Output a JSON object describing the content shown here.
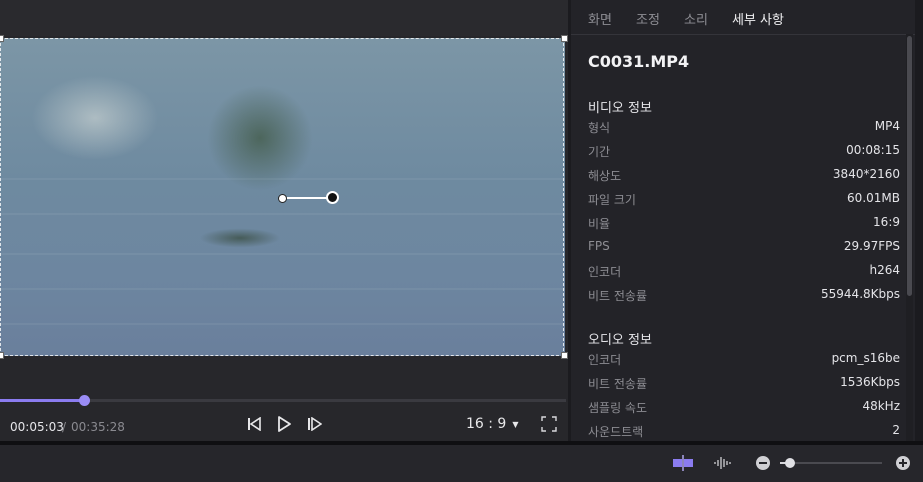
{
  "player": {
    "time_current": "00:05:03",
    "time_separator": "/",
    "time_total": "00:35:28",
    "progress_fraction": 0.148,
    "aspect_ratio": "16 : 9",
    "icons": {
      "prev_frame": "step-back-icon",
      "play": "play-icon",
      "next_frame": "step-forward-icon",
      "dropdown": "caret-down-icon",
      "fullscreen": "fullscreen-icon"
    }
  },
  "tabs": [
    {
      "label": "화면",
      "active": false
    },
    {
      "label": "조정",
      "active": false
    },
    {
      "label": "소리",
      "active": false
    },
    {
      "label": "세부 사항",
      "active": true
    }
  ],
  "file": {
    "name": "C0031.MP4"
  },
  "video_info": {
    "heading": "비디오 정보",
    "rows": [
      {
        "key": "형식",
        "value": "MP4"
      },
      {
        "key": "기간",
        "value": "00:08:15"
      },
      {
        "key": "해상도",
        "value": "3840*2160"
      },
      {
        "key": "파일 크기",
        "value": "60.01MB"
      },
      {
        "key": "비율",
        "value": "16:9"
      },
      {
        "key": "FPS",
        "value": "29.97FPS"
      },
      {
        "key": "인코더",
        "value": "h264"
      },
      {
        "key": "비트 전송률",
        "value": "55944.8Kbps"
      }
    ]
  },
  "audio_info": {
    "heading": "오디오 정보",
    "rows": [
      {
        "key": "인코더",
        "value": "pcm_s16be"
      },
      {
        "key": "비트 전송률",
        "value": "1536Kbps"
      },
      {
        "key": "샘플링 속도",
        "value": "48kHz"
      },
      {
        "key": "사운드트랙",
        "value": "2"
      }
    ]
  },
  "timeline_toolbar": {
    "zoom_fraction": 0.1,
    "icons": [
      "snap-icon",
      "waveform-icon",
      "zoom-out-icon",
      "zoom-in-icon"
    ]
  },
  "colors": {
    "accent": "#8b7cf0",
    "panel_bg": "#232328",
    "preview_bg": "#27272b"
  }
}
